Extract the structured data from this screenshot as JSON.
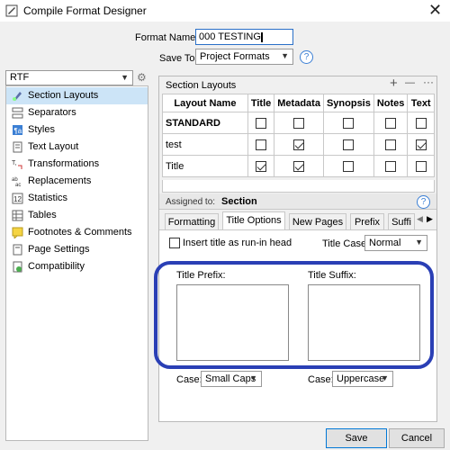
{
  "window": {
    "title": "Compile Format Designer"
  },
  "top": {
    "format_name_label": "Format Name:",
    "format_name_value": "000 TESTING",
    "save_to_label": "Save To:",
    "save_to_value": "Project Formats"
  },
  "format_type": "RTF",
  "sidebar": {
    "items": [
      {
        "label": "Section Layouts",
        "icon": "section-layouts-icon"
      },
      {
        "label": "Separators",
        "icon": "separators-icon"
      },
      {
        "label": "Styles",
        "icon": "styles-icon"
      },
      {
        "label": "Text Layout",
        "icon": "text-layout-icon"
      },
      {
        "label": "Transformations",
        "icon": "transformations-icon"
      },
      {
        "label": "Replacements",
        "icon": "replacements-icon"
      },
      {
        "label": "Statistics",
        "icon": "statistics-icon"
      },
      {
        "label": "Tables",
        "icon": "tables-icon"
      },
      {
        "label": "Footnotes & Comments",
        "icon": "footnotes-icon"
      },
      {
        "label": "Page Settings",
        "icon": "page-settings-icon"
      },
      {
        "label": "Compatibility",
        "icon": "compatibility-icon"
      }
    ],
    "selected_index": 0
  },
  "section_layouts": {
    "header": "Section Layouts",
    "add_symbol": "+",
    "remove_symbol": "—",
    "more_symbol": "···",
    "columns": [
      "Layout Name",
      "Title",
      "Metadata",
      "Synopsis",
      "Notes",
      "Text"
    ],
    "rows": [
      {
        "name": "STANDARD",
        "bold": true,
        "checks": [
          false,
          false,
          false,
          false,
          false
        ]
      },
      {
        "name": "test",
        "bold": false,
        "checks": [
          false,
          true,
          false,
          false,
          true
        ]
      },
      {
        "name": "Title",
        "bold": false,
        "checks": [
          true,
          true,
          false,
          false,
          false
        ]
      }
    ]
  },
  "assigned": {
    "label": "Assigned to:",
    "value": "Section"
  },
  "tabs": [
    "Formatting",
    "Title Options",
    "New Pages",
    "Prefix",
    "Suffi"
  ],
  "active_tab": "Title Options",
  "title_options": {
    "runin_label": "Insert title as run-in head",
    "runin_checked": false,
    "title_case_label": "Title Case:",
    "title_case_value": "Normal",
    "prefix_label": "Title Prefix:",
    "suffix_label": "Title Suffix:",
    "prefix_case_label": "Case:",
    "prefix_case_value": "Small Caps",
    "suffix_case_label": "Case:",
    "suffix_case_value": "Uppercase"
  },
  "buttons": {
    "save": "Save",
    "cancel": "Cancel"
  },
  "colors": {
    "highlight": "#2a3fb5",
    "selection": "#cce4f7",
    "accent": "#3b7fd4"
  }
}
